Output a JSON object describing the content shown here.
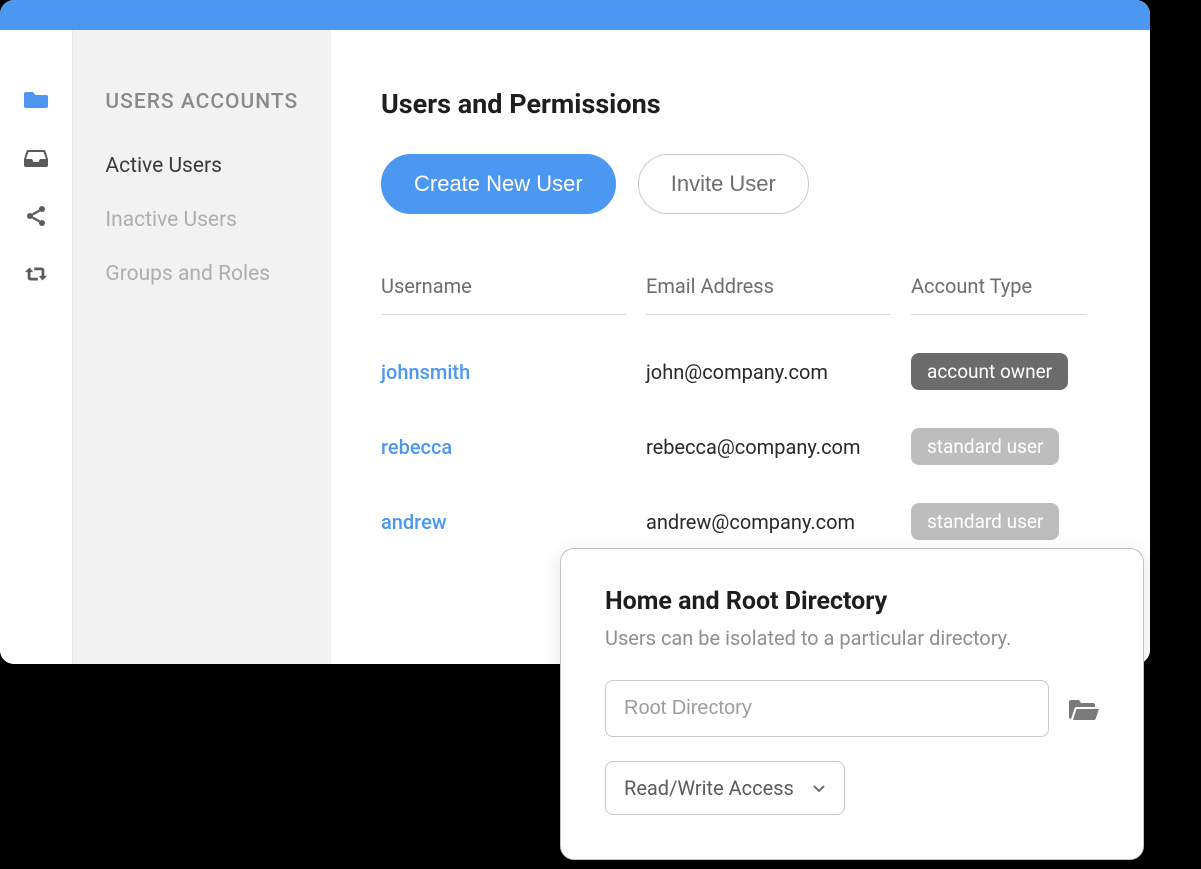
{
  "colors": {
    "accent": "#4b97f2"
  },
  "sidebar": {
    "title": "USERS ACCOUNTS",
    "items": [
      {
        "label": "Active Users",
        "active": true
      },
      {
        "label": "Inactive Users",
        "active": false
      },
      {
        "label": "Groups and Roles",
        "active": false
      }
    ]
  },
  "rail": {
    "icons": [
      "folder",
      "inbox",
      "share",
      "retweet"
    ]
  },
  "main": {
    "title": "Users and Permissions",
    "buttons": {
      "create": "Create New User",
      "invite": "Invite User"
    },
    "columns": {
      "username": "Username",
      "email": "Email Address",
      "type": "Account Type"
    },
    "rows": [
      {
        "username": "johnsmith",
        "email": "john@company.com",
        "type": "account owner",
        "type_kind": "owner"
      },
      {
        "username": "rebecca",
        "email": "rebecca@company.com",
        "type": "standard user",
        "type_kind": "standard"
      },
      {
        "username": "andrew",
        "email": "andrew@company.com",
        "type": "standard user",
        "type_kind": "standard"
      }
    ]
  },
  "panel": {
    "title": "Home and Root Directory",
    "subtitle": "Users can be isolated to a particular directory.",
    "root_placeholder": "Root Directory",
    "access_selected": "Read/Write Access"
  }
}
